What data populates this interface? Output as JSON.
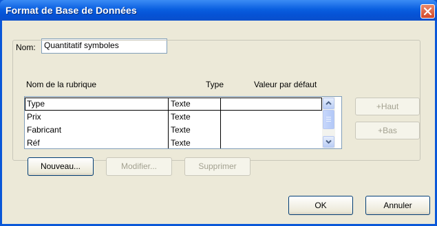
{
  "window": {
    "title": "Format de Base de Données"
  },
  "name_field": {
    "label": "Nom:",
    "value": "Quantitatif symboles"
  },
  "list": {
    "columns": [
      "Nom de la rubrique",
      "Type",
      "Valeur par défaut"
    ],
    "rows": [
      {
        "name": "Type",
        "type": "Texte",
        "default": ""
      },
      {
        "name": "Prix",
        "type": "Texte",
        "default": ""
      },
      {
        "name": "Fabricant",
        "type": "Texte",
        "default": ""
      },
      {
        "name": "Réf",
        "type": "Texte",
        "default": ""
      }
    ]
  },
  "buttons": {
    "new": "Nouveau...",
    "modify": "Modifier...",
    "delete": "Supprimer",
    "up": "+Haut",
    "down": "+Bas",
    "ok": "OK",
    "cancel": "Annuler"
  },
  "icons": {
    "close": "close-icon",
    "scroll_up": "chevron-up-icon",
    "scroll_down": "chevron-down-icon"
  },
  "colors": {
    "title_bar": "#0a5fe0",
    "dialog_face": "#ece9d8",
    "close_button": "#d3482a"
  }
}
